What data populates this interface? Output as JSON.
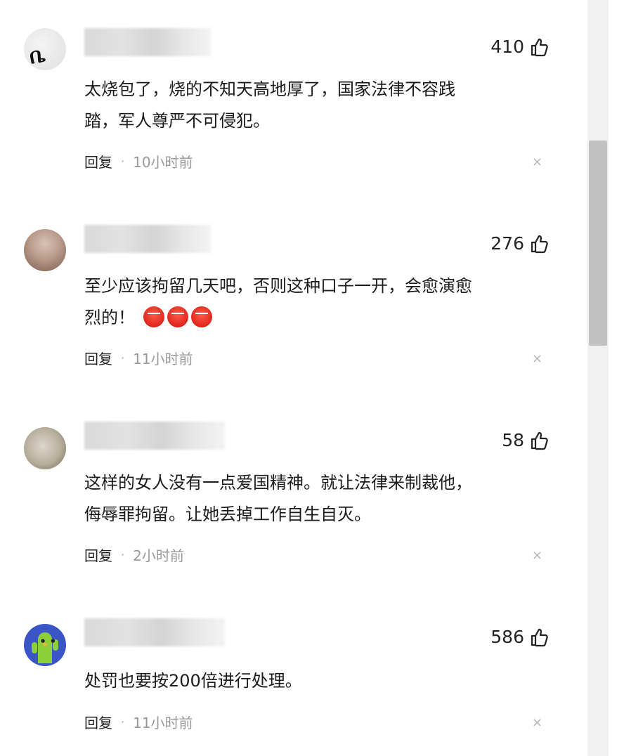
{
  "comments": [
    {
      "likes": "410",
      "text_line1": "太烧包了，烧的不知天高地厚了，国家法律不容践",
      "text_line2": "踏，军人尊严不可侵犯。",
      "reply": "回复",
      "dot": "·",
      "time": "10小时前",
      "close": "×"
    },
    {
      "likes": "276",
      "text_line1": "至少应该拘留几天吧，否则这种口子一开，会愈演愈",
      "text_line2": "烈的！",
      "emoji": "angry-face",
      "reply": "回复",
      "dot": "·",
      "time": "11小时前",
      "close": "×"
    },
    {
      "likes": "58",
      "text_line1": "这样的女人没有一点爱国精神。就让法律来制裁他，",
      "text_line2": "侮辱罪拘留。让她丢掉工作自生自灭。",
      "reply": "回复",
      "dot": "·",
      "time": "2小时前",
      "close": "×"
    },
    {
      "likes": "586",
      "text_line1": "处罚也要按200倍进行处理。",
      "reply": "回复",
      "dot": "·",
      "time": "11小时前",
      "close": "×"
    }
  ]
}
